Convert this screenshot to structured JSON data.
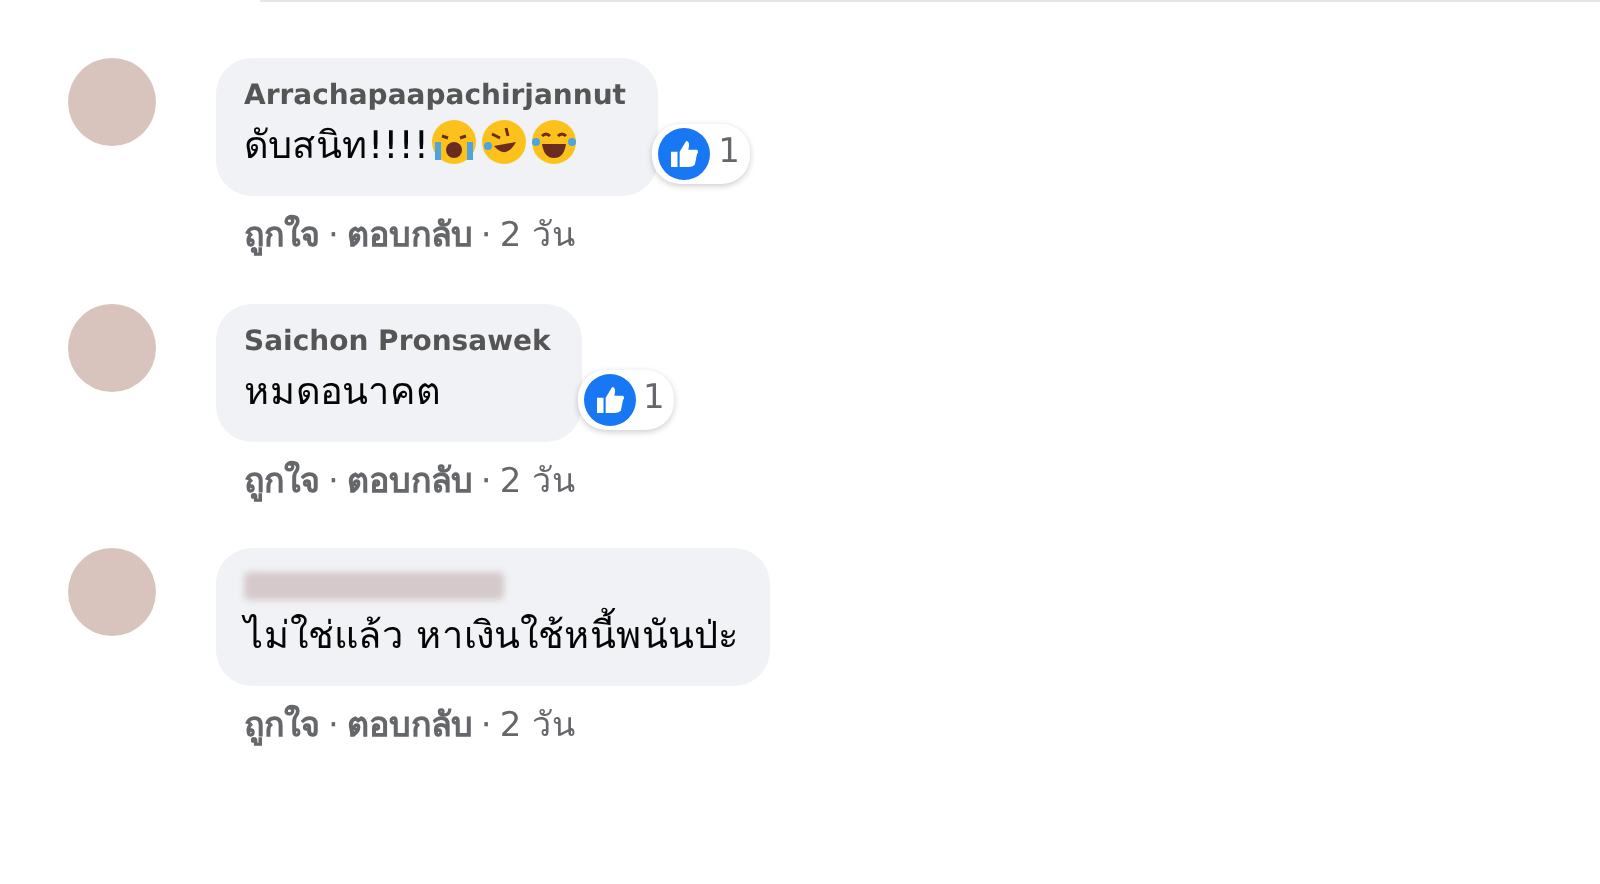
{
  "comments": [
    {
      "author": "Arrachapaapachirjannut",
      "author_legible": true,
      "text": "ดับสนิท!!!!",
      "emojis": [
        {
          "kind": "crying"
        },
        {
          "kind": "rofl"
        },
        {
          "kind": "laughing"
        }
      ],
      "likes": "1",
      "actions": [
        "ถูกใจ",
        "·",
        "ตอบกลับ",
        "·",
        "2 วัน"
      ]
    },
    {
      "author": "Saichon Pronsawek",
      "author_legible": true,
      "text": "หมดอนาคต",
      "likes": "1",
      "actions": [
        "ถูกใจ",
        "·",
        "ตอบกลับ",
        "·",
        "2 วัน"
      ]
    },
    {
      "author_legible": false,
      "text": "ไม่ใช่แล้ว หาเงินใช้หนี้พนันป่ะ",
      "actions": [
        "ถูกใจ",
        "·",
        "ตอบกลับ",
        "·",
        "2 วัน"
      ]
    }
  ]
}
